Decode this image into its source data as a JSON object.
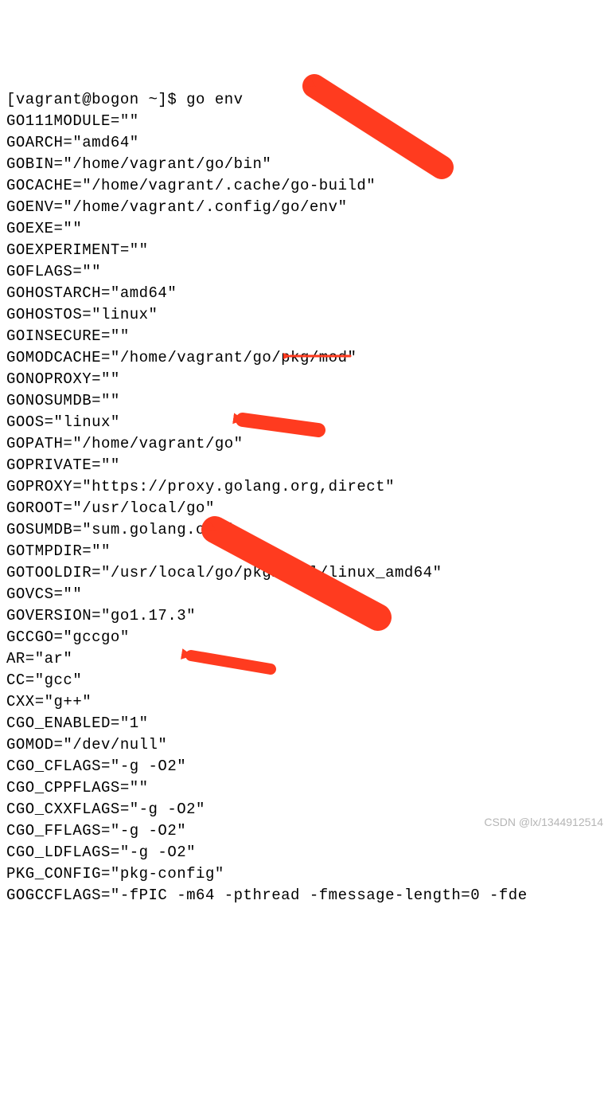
{
  "prompt": "[vagrant@bogon ~]$ go env",
  "env": [
    {
      "key": "GO111MODULE",
      "val": "\"\""
    },
    {
      "key": "GOARCH",
      "val": "\"amd64\""
    },
    {
      "key": "GOBIN",
      "val": "\"/home/vagrant/go/bin\""
    },
    {
      "key": "GOCACHE",
      "val": "\"/home/vagrant/.cache/go-build\""
    },
    {
      "key": "GOENV",
      "val": "\"/home/vagrant/.config/go/env\""
    },
    {
      "key": "GOEXE",
      "val": "\"\""
    },
    {
      "key": "GOEXPERIMENT",
      "val": "\"\""
    },
    {
      "key": "GOFLAGS",
      "val": "\"\""
    },
    {
      "key": "GOHOSTARCH",
      "val": "\"amd64\""
    },
    {
      "key": "GOHOSTOS",
      "val": "\"linux\""
    },
    {
      "key": "GOINSECURE",
      "val": "\"\""
    },
    {
      "key": "GOMODCACHE",
      "val": "\"/home/vagrant/go/pkg/mod\""
    },
    {
      "key": "GONOPROXY",
      "val": "\"\""
    },
    {
      "key": "GONOSUMDB",
      "val": "\"\""
    },
    {
      "key": "GOOS",
      "val": "\"linux\""
    },
    {
      "key": "GOPATH",
      "val": "\"/home/vagrant/go\""
    },
    {
      "key": "GOPRIVATE",
      "val": "\"\""
    },
    {
      "key": "GOPROXY",
      "val": "\"https://proxy.golang.org,direct\""
    },
    {
      "key": "GOROOT",
      "val": "\"/usr/local/go\""
    },
    {
      "key": "GOSUMDB",
      "val": "\"sum.golang.org\""
    },
    {
      "key": "GOTMPDIR",
      "val": "\"\""
    },
    {
      "key": "GOTOOLDIR",
      "val": "\"/usr/local/go/pkg/tool/linux_amd64\""
    },
    {
      "key": "GOVCS",
      "val": "\"\""
    },
    {
      "key": "GOVERSION",
      "val": "\"go1.17.3\""
    },
    {
      "key": "GCCGO",
      "val": "\"gccgo\""
    },
    {
      "key": "AR",
      "val": "\"ar\""
    },
    {
      "key": "CC",
      "val": "\"gcc\""
    },
    {
      "key": "CXX",
      "val": "\"g++\""
    },
    {
      "key": "CGO_ENABLED",
      "val": "\"1\""
    },
    {
      "key": "GOMOD",
      "val": "\"/dev/null\""
    },
    {
      "key": "CGO_CFLAGS",
      "val": "\"-g -O2\""
    },
    {
      "key": "CGO_CPPFLAGS",
      "val": "\"\""
    },
    {
      "key": "CGO_CXXFLAGS",
      "val": "\"-g -O2\""
    },
    {
      "key": "CGO_FFLAGS",
      "val": "\"-g -O2\""
    },
    {
      "key": "CGO_LDFLAGS",
      "val": "\"-g -O2\""
    },
    {
      "key": "PKG_CONFIG",
      "val": "\"pkg-config\""
    },
    {
      "key": "GOGCCFLAGS",
      "val": "\"-fPIC -m64 -pthread -fmessage-length=0 -fde"
    }
  ],
  "watermark": "CSDN @lx/1344912514",
  "arrow_color": "#ff3b1f"
}
